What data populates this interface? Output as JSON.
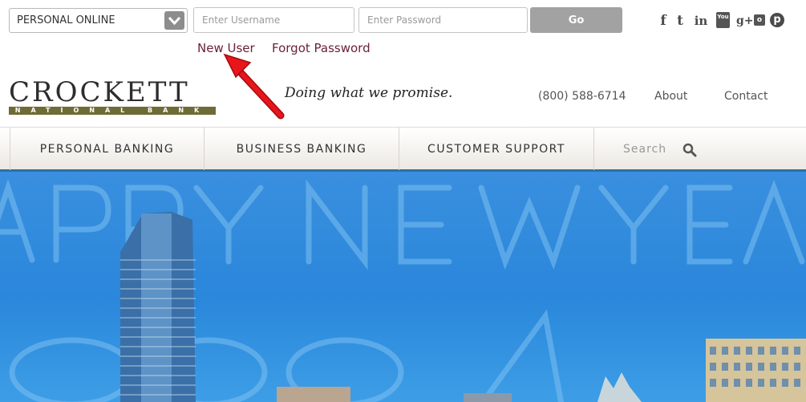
{
  "login": {
    "account_type": "PERSONAL ONLINE",
    "username_placeholder": "Enter Username",
    "password_placeholder": "Enter Password",
    "go_label": "Go",
    "new_user_label": "New User",
    "forgot_password_label": "Forgot Password"
  },
  "social": [
    "f",
    "t",
    "in",
    "You",
    "g+",
    "o",
    "p"
  ],
  "header": {
    "logo_word": "CROCKETT",
    "logo_sub": "NATIONAL BANK",
    "tagline": "Doing what we promise.",
    "phone": "(800) 588-6714",
    "about_label": "About",
    "contact_label": "Contact"
  },
  "nav": {
    "items": [
      "PERSONAL BANKING",
      "BUSINESS BANKING",
      "CUSTOMER SUPPORT"
    ],
    "search_label": "Search"
  },
  "colors": {
    "brand_maroon": "#6a2238",
    "logo_band": "#6f6b36",
    "nav_accent": "#2d6fa8",
    "annotation_arrow": "#e8151b"
  }
}
